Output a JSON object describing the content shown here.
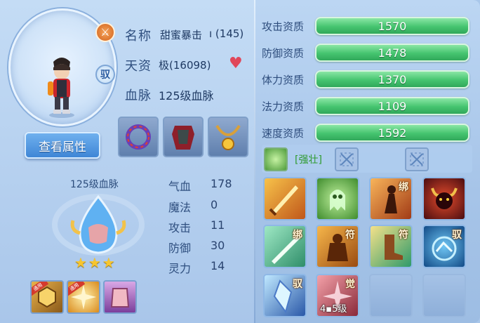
{
  "pet": {
    "name_label": "名称",
    "name_value": "甜蜜暴击",
    "name_suffix": "ı (145)",
    "talent_label": "天资",
    "talent_value": "极(16098)",
    "bloodline_label": "血脉",
    "bloodline_value": "125级血脉",
    "view_button": "查看属性",
    "type_badge": "驭"
  },
  "bloodline": {
    "title": "125级血脉",
    "stars": "★★★",
    "star_count": 3,
    "skill_tags": [
      "通用",
      "通用"
    ]
  },
  "stats": [
    {
      "label": "气血",
      "value": "178"
    },
    {
      "label": "魔法",
      "value": "0"
    },
    {
      "label": "攻击",
      "value": "11"
    },
    {
      "label": "防御",
      "value": "30"
    },
    {
      "label": "灵力",
      "value": "14"
    }
  ],
  "aptitudes": [
    {
      "label": "攻击资质",
      "value": "1570"
    },
    {
      "label": "防御资质",
      "value": "1478"
    },
    {
      "label": "体力资质",
      "value": "1370"
    },
    {
      "label": "法力资质",
      "value": "1109"
    },
    {
      "label": "速度资质",
      "value": "1592"
    }
  ],
  "trait": {
    "name": "[强壮]"
  },
  "skills": [
    {
      "mark": "",
      "level": ""
    },
    {
      "mark": "",
      "level": ""
    },
    {
      "mark": "绑",
      "level": ""
    },
    {
      "mark": "",
      "level": ""
    },
    {
      "mark": "绑",
      "level": ""
    },
    {
      "mark": "符",
      "level": ""
    },
    {
      "mark": "符",
      "level": ""
    },
    {
      "mark": "驭",
      "level": ""
    },
    {
      "mark": "驭",
      "level": ""
    },
    {
      "mark": "觉",
      "level": "4▪5级"
    }
  ],
  "colors": {
    "bar_green": "#45c46f",
    "panel_blue": "#a9c7ea",
    "button_blue": "#3f86d6",
    "trait_green": "#2e9a2e"
  }
}
